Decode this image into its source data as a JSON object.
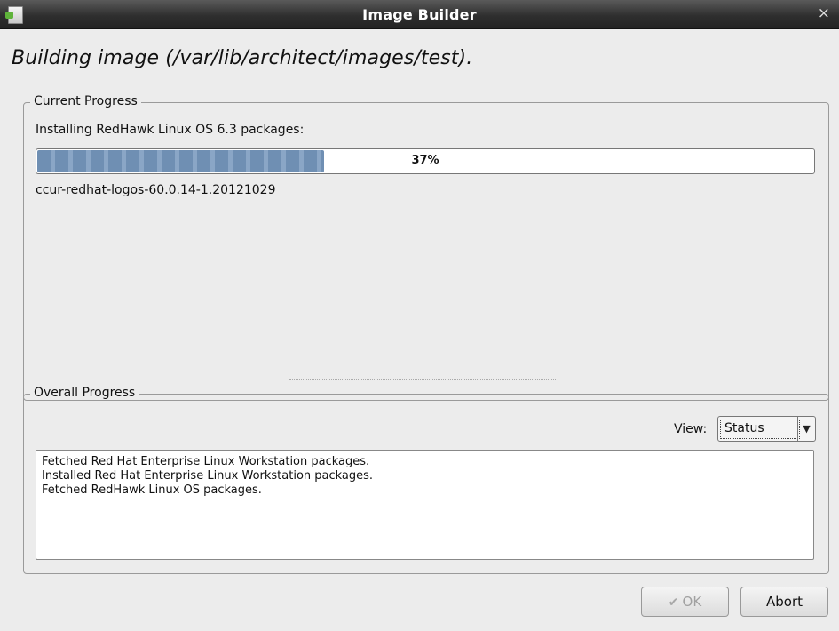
{
  "window": {
    "title": "Image Builder",
    "close_glyph": "×",
    "app_icon": "document-icon"
  },
  "heading": "Building image (/var/lib/architect/images/test).",
  "current_progress": {
    "legend": "Current Progress",
    "task": "Installing RedHawk Linux OS 6.3 packages:",
    "progress_percent": 37,
    "progress_label": "37%",
    "package": "ccur-redhat-logos-60.0.14-1.20121029"
  },
  "overall_progress": {
    "legend": "Overall Progress",
    "view_label": "View:",
    "view_selected": "Status",
    "log_lines": [
      "Fetched Red Hat Enterprise Linux Workstation packages.",
      "Installed Red Hat Enterprise Linux Workstation packages.",
      "Fetched RedHawk Linux OS packages."
    ]
  },
  "buttons": {
    "ok_label": "OK",
    "ok_icon": "thumbs-up-icon",
    "abort_label": "Abort"
  },
  "colors": {
    "progress_fill": "#7b99bc",
    "titlebar": "#3a3a3a"
  }
}
